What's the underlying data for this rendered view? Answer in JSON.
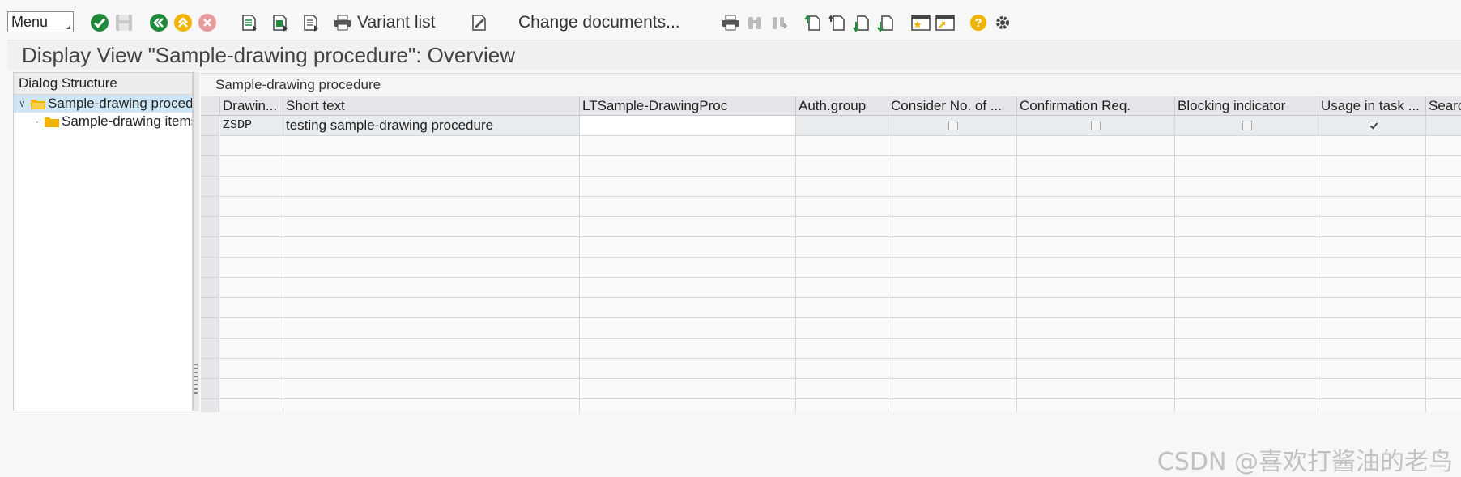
{
  "toolbar": {
    "menu_label": "Menu",
    "variant_list_label": "Variant list",
    "change_documents_label": "Change documents...",
    "accent_green": "#1f8a3b",
    "accent_yellow": "#f0b400",
    "accent_red": "#e05a5a"
  },
  "page": {
    "title": "Display View \"Sample-drawing procedure\": Overview"
  },
  "dialog_structure": {
    "header": "Dialog Structure",
    "items": [
      {
        "label": "Sample-drawing procedure",
        "selected": true
      },
      {
        "label": "Sample-drawing items",
        "selected": false
      }
    ]
  },
  "table": {
    "caption": "Sample-drawing procedure",
    "columns": [
      "Drawin...",
      "Short text",
      "LTSample-DrawingProc",
      "Auth.group",
      "Consider No. of ...",
      "Confirmation Req.",
      "Blocking indicator",
      "Usage in task ...",
      "Search"
    ],
    "rows": [
      {
        "drawing_proc": "ZSDP",
        "short_text": "testing sample-drawing procedure",
        "long_text": "",
        "auth_group": "",
        "consider_no": false,
        "confirmation_req": false,
        "blocking_indicator": false,
        "usage_in_task": true
      }
    ]
  },
  "watermark": "CSDN @喜欢打酱油的老鸟"
}
